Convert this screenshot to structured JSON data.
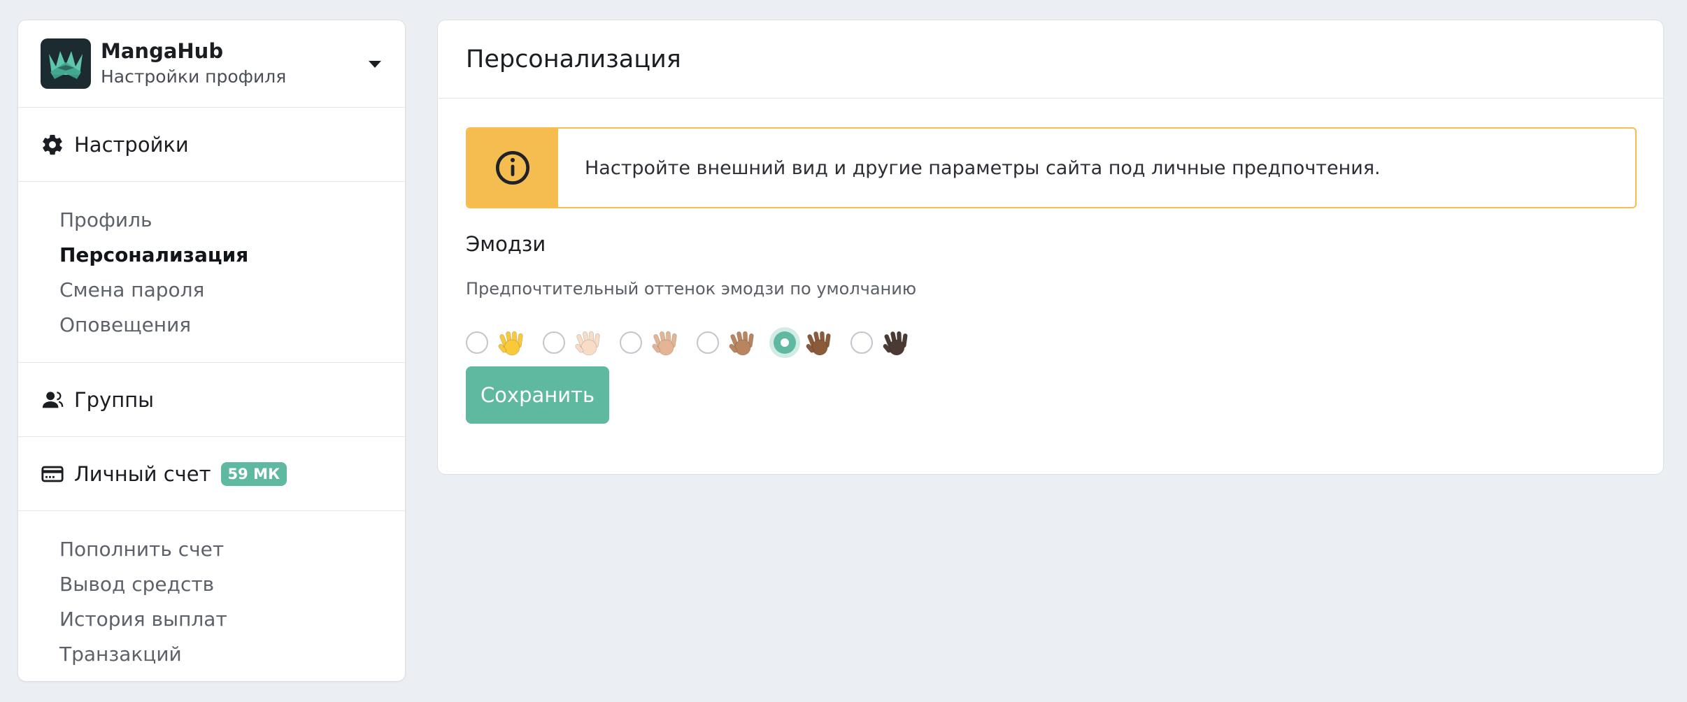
{
  "brand": {
    "name": "MangaHub",
    "subtitle": "Настройки профиля"
  },
  "sidebar": {
    "settings": {
      "label": "Настройки",
      "icon": "gear-icon"
    },
    "settings_items": [
      {
        "label": "Профиль"
      },
      {
        "label": "Персонализация"
      },
      {
        "label": "Смена пароля"
      },
      {
        "label": "Оповещения"
      }
    ],
    "groups": {
      "label": "Группы",
      "icon": "user-group-icon"
    },
    "account": {
      "label": "Личный счет",
      "badge": "59 МК",
      "icon": "credit-card-icon"
    },
    "account_items": [
      {
        "label": "Пополнить счет"
      },
      {
        "label": "Вывод средств"
      },
      {
        "label": "История выплат"
      },
      {
        "label": "Транзакций"
      }
    ]
  },
  "main": {
    "title": "Персонализация",
    "alert": {
      "text": "Настройте внешний вид и другие параметры сайта под личные предпочтения.",
      "icon": "info-icon"
    },
    "emoji": {
      "title": "Эмодзи",
      "label": "Предпочтительный оттенок эмодзи по умолчанию",
      "options": [
        {
          "tone": "default",
          "color": "#f9c93a"
        },
        {
          "tone": "light",
          "color": "#f8dcc7"
        },
        {
          "tone": "medium-light",
          "color": "#e3b594"
        },
        {
          "tone": "medium",
          "color": "#b98560"
        },
        {
          "tone": "medium-dark",
          "color": "#8b5a3b"
        },
        {
          "tone": "dark",
          "color": "#4b3a33"
        }
      ],
      "selected_index": 4
    },
    "save_label": "Сохранить"
  },
  "colors": {
    "accent": "#5fb8a0",
    "warning": "#f5bd4f",
    "background": "#ebeef3"
  }
}
